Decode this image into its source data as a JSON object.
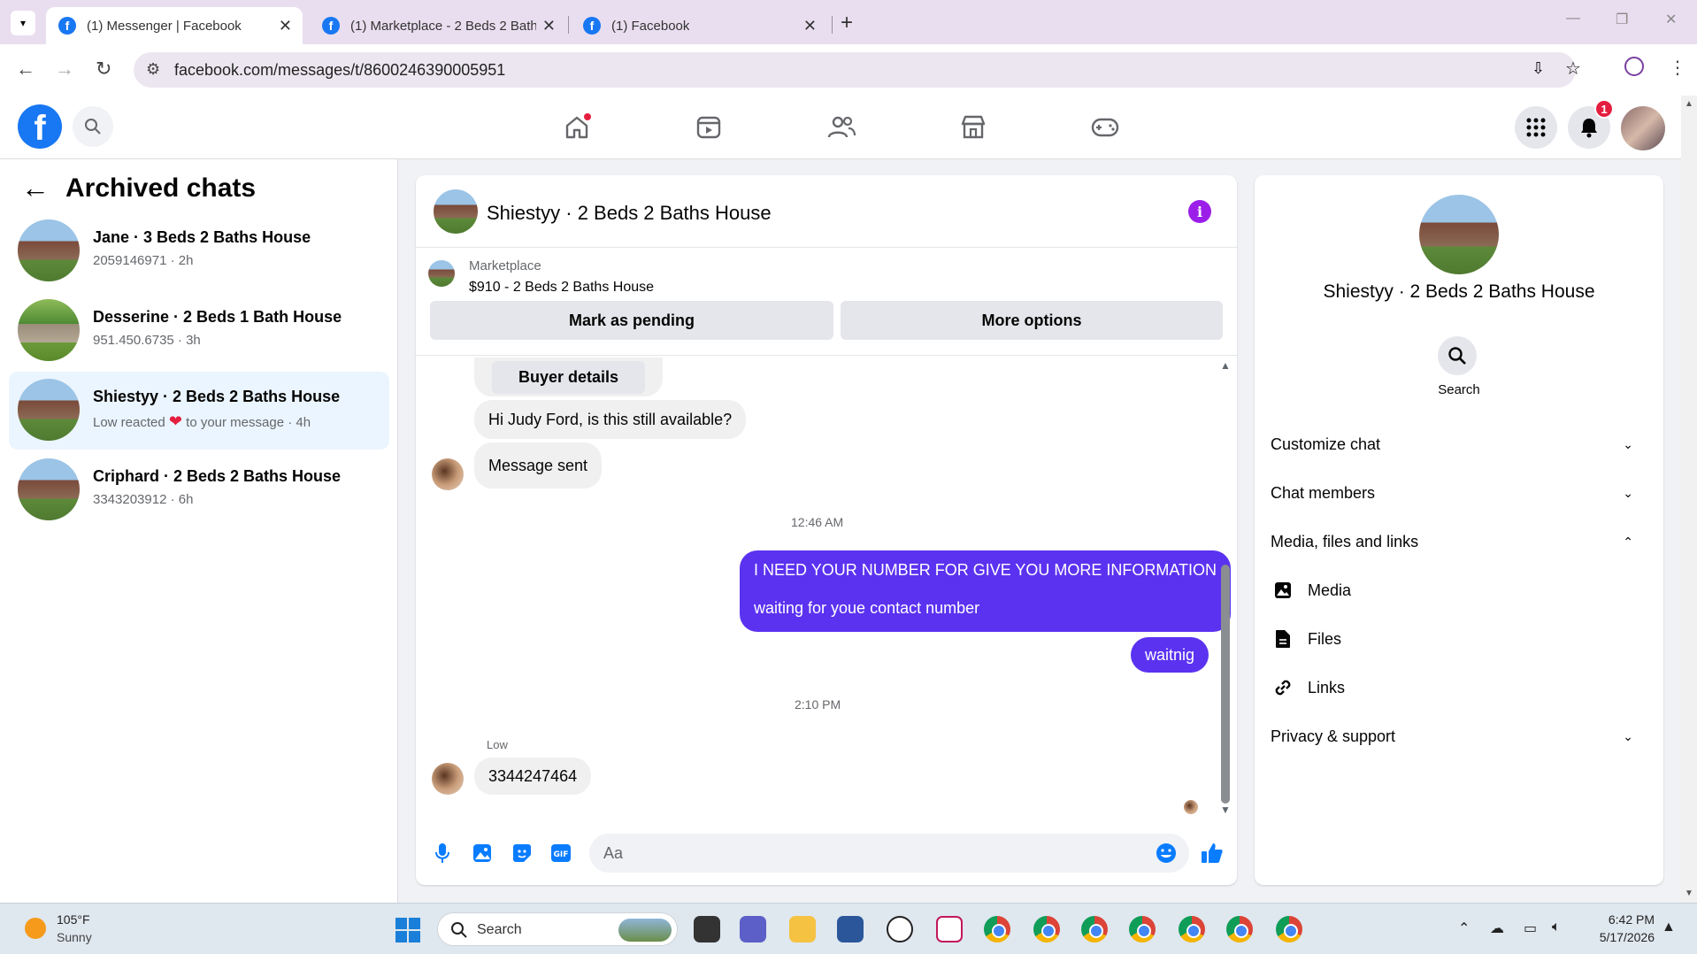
{
  "browser": {
    "tabs": [
      {
        "title": "(1) Messenger | Facebook"
      },
      {
        "title": "(1) Marketplace - 2 Beds 2 Bath"
      },
      {
        "title": "(1) Facebook"
      }
    ],
    "url": "facebook.com/messages/t/8600246390005951"
  },
  "fbnav": {
    "notification_count": "1"
  },
  "sidebar": {
    "title": "Archived chats",
    "conversations": [
      {
        "name": "Jane · 3 Beds 2 Baths House",
        "sub": "2059146971 · 2h"
      },
      {
        "name": "Desserine · 2 Beds 1 Bath House",
        "sub": "951.450.6735 · 3h"
      },
      {
        "name": "Shiestyy · 2 Beds 2 Baths House",
        "sub_prefix": "Low reacted",
        "sub_suffix": "to your message · 4h"
      },
      {
        "name": "Criphard · 2 Beds 2 Baths House",
        "sub": "3343203912 · 6h"
      }
    ]
  },
  "chat": {
    "title": "Shiestyy · 2 Beds 2 Baths House",
    "marketplace_label": "Marketplace",
    "listing": "$910 - 2 Beds 2 Baths House",
    "mark_pending_label": "Mark as pending",
    "more_options_label": "More options",
    "messages": {
      "buyer_details": "Buyer details",
      "inquiry": "Hi Judy Ford, is this still available?",
      "sent": "Message sent",
      "time1": "12:46 AM",
      "out_line1": "I NEED YOUR NUMBER FOR GIVE YOU MORE INFORMATION",
      "out_line2": "waiting for youe contact number",
      "out2": "waitnig",
      "time2": "2:10 PM",
      "sender": "Low",
      "in_number": "3344247464"
    },
    "composer_placeholder": "Aa"
  },
  "info_panel": {
    "name": "Shiestyy · 2 Beds 2 Baths House",
    "search_label": "Search",
    "rows": {
      "customize": "Customize chat",
      "members": "Chat members",
      "media_files": "Media, files and links",
      "media": "Media",
      "files": "Files",
      "links": "Links",
      "privacy": "Privacy & support"
    }
  },
  "taskbar": {
    "temp": "105°F",
    "weather": "Sunny",
    "search_label": "Search",
    "time": "6:42 PM",
    "date": "5/17/2026"
  },
  "colors": {
    "accent": "#5b32f0",
    "fb_blue": "#1877f2",
    "info_purple": "#9b1fe8"
  }
}
